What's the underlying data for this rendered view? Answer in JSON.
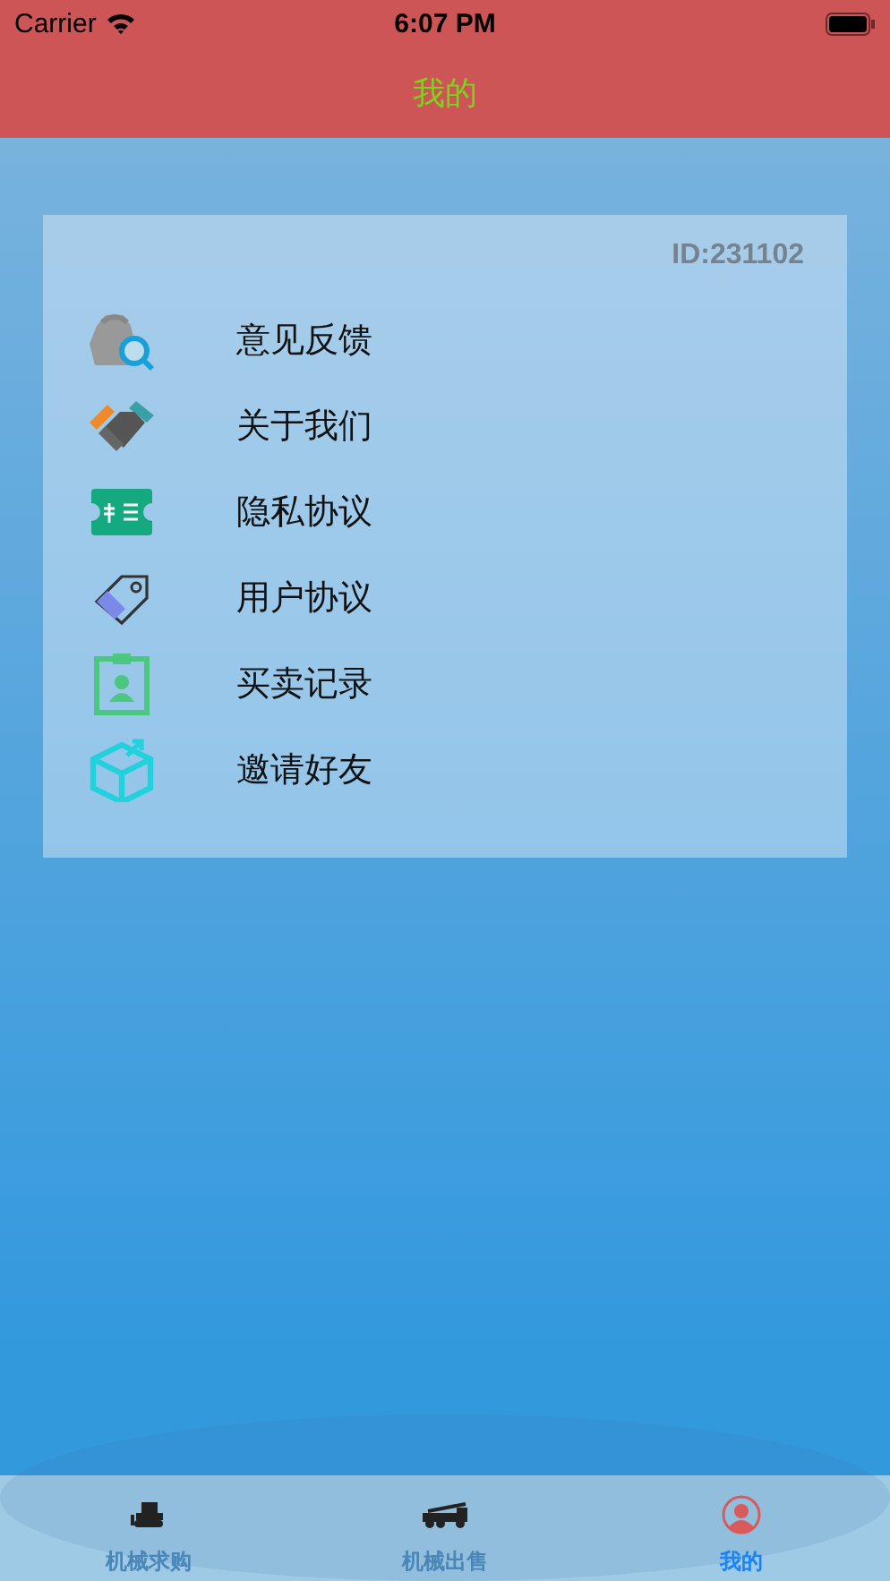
{
  "status_bar": {
    "carrier": "Carrier",
    "time": "6:07 PM"
  },
  "nav_bar": {
    "title": "我的"
  },
  "card": {
    "user_id": "ID:231102",
    "items": [
      {
        "label": "意见反馈"
      },
      {
        "label": "关于我们"
      },
      {
        "label": "隐私协议"
      },
      {
        "label": "用户协议"
      },
      {
        "label": "买卖记录"
      },
      {
        "label": "邀请好友"
      }
    ]
  },
  "tab_bar": [
    {
      "label": "机械求购",
      "selected": false
    },
    {
      "label": "机械出售",
      "selected": false
    },
    {
      "label": "我的",
      "selected": true
    }
  ]
}
